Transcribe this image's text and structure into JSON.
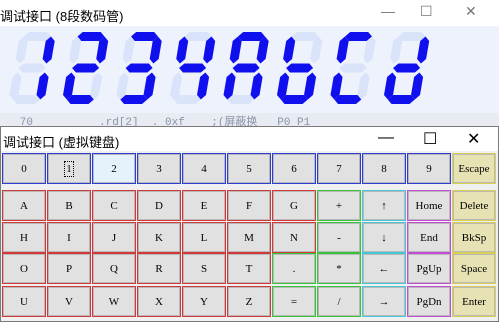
{
  "colors": {
    "segment_on": "#1010ee",
    "segment_off": "#d9e3f9",
    "display_bg": "#eef2fc"
  },
  "back_window": {
    "title": "调试接口 (8段数码管)",
    "controls": {
      "minimize": "—",
      "maximize": "☐",
      "close": "✕"
    },
    "display_chars": [
      "1",
      "2",
      "3",
      "4",
      "A",
      "b",
      "C",
      "d"
    ],
    "strip_text": "   70          .rd[2]  . 0xf    ;(屏蔽换   P0 P1   "
  },
  "front_window": {
    "title": "调试接口 (虚拟键盘)",
    "controls": {
      "minimize": "—",
      "maximize": "☐",
      "close": "✕"
    },
    "rows": [
      [
        {
          "label": "0",
          "group": "num"
        },
        {
          "label": "1",
          "group": "num",
          "state": "focus"
        },
        {
          "label": "2",
          "group": "num",
          "state": "selected"
        },
        {
          "label": "3",
          "group": "num"
        },
        {
          "label": "4",
          "group": "num"
        },
        {
          "label": "5",
          "group": "num"
        },
        {
          "label": "6",
          "group": "num"
        },
        {
          "label": "7",
          "group": "num"
        },
        {
          "label": "8",
          "group": "num"
        },
        {
          "label": "9",
          "group": "num"
        },
        {
          "label": "Escape",
          "group": "ctl"
        }
      ],
      [
        {
          "label": "A",
          "group": "alpha"
        },
        {
          "label": "B",
          "group": "alpha"
        },
        {
          "label": "C",
          "group": "alpha"
        },
        {
          "label": "D",
          "group": "alpha"
        },
        {
          "label": "E",
          "group": "alpha"
        },
        {
          "label": "F",
          "group": "alpha"
        },
        {
          "label": "G",
          "group": "alpha"
        },
        {
          "label": "+",
          "group": "op"
        },
        {
          "label": "↑",
          "group": "arrow"
        },
        {
          "label": "Home",
          "group": "nav"
        },
        {
          "label": "Delete",
          "group": "ctl"
        }
      ],
      [
        {
          "label": "H",
          "group": "alpha"
        },
        {
          "label": "I",
          "group": "alpha"
        },
        {
          "label": "J",
          "group": "alpha"
        },
        {
          "label": "K",
          "group": "alpha"
        },
        {
          "label": "L",
          "group": "alpha"
        },
        {
          "label": "M",
          "group": "alpha"
        },
        {
          "label": "N",
          "group": "alpha"
        },
        {
          "label": "-",
          "group": "op"
        },
        {
          "label": "↓",
          "group": "arrow"
        },
        {
          "label": "End",
          "group": "nav"
        },
        {
          "label": "BkSp",
          "group": "ctl"
        }
      ],
      [
        {
          "label": "O",
          "group": "alpha"
        },
        {
          "label": "P",
          "group": "alpha"
        },
        {
          "label": "Q",
          "group": "alpha"
        },
        {
          "label": "R",
          "group": "alpha"
        },
        {
          "label": "S",
          "group": "alpha"
        },
        {
          "label": "T",
          "group": "alpha"
        },
        {
          "label": ".",
          "group": "op"
        },
        {
          "label": "*",
          "group": "op"
        },
        {
          "label": "←",
          "group": "arrow"
        },
        {
          "label": "PgUp",
          "group": "nav"
        },
        {
          "label": "Space",
          "group": "ctl"
        }
      ],
      [
        {
          "label": "U",
          "group": "alpha"
        },
        {
          "label": "V",
          "group": "alpha"
        },
        {
          "label": "W",
          "group": "alpha"
        },
        {
          "label": "X",
          "group": "alpha"
        },
        {
          "label": "Y",
          "group": "alpha"
        },
        {
          "label": "Z",
          "group": "alpha"
        },
        {
          "label": "=",
          "group": "op"
        },
        {
          "label": "/",
          "group": "op"
        },
        {
          "label": "→",
          "group": "arrow"
        },
        {
          "label": "PgDn",
          "group": "nav"
        },
        {
          "label": "Enter",
          "group": "ctl"
        }
      ]
    ]
  }
}
